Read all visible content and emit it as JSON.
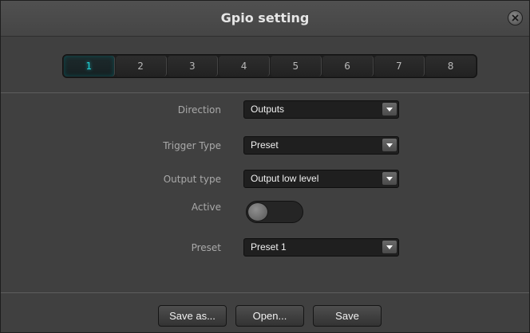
{
  "window": {
    "title": "Gpio setting",
    "close_icon": "close-icon"
  },
  "tabs": [
    {
      "label": "1",
      "active": true
    },
    {
      "label": "2",
      "active": false
    },
    {
      "label": "3",
      "active": false
    },
    {
      "label": "4",
      "active": false
    },
    {
      "label": "5",
      "active": false
    },
    {
      "label": "6",
      "active": false
    },
    {
      "label": "7",
      "active": false
    },
    {
      "label": "8",
      "active": false
    }
  ],
  "form": {
    "direction": {
      "label": "Direction",
      "value": "Outputs"
    },
    "trigger_type": {
      "label": "Trigger Type",
      "value": "Preset"
    },
    "output_type": {
      "label": "Output type",
      "value": "Output low level"
    },
    "active": {
      "label": "Active",
      "on": false
    },
    "preset": {
      "label": "Preset",
      "value": "Preset 1"
    }
  },
  "buttons": {
    "save_as": "Save as...",
    "open": "Open...",
    "save": "Save"
  },
  "colors": {
    "accent": "#1fd1d6",
    "background": "#404040"
  }
}
